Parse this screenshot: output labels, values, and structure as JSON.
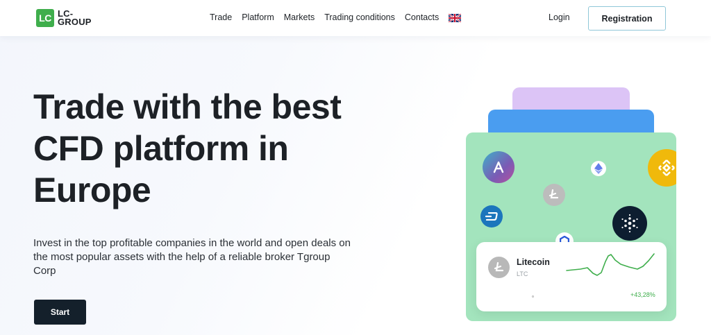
{
  "header": {
    "logo_mark": "LC",
    "logo_text": "LC-GROUP",
    "nav": [
      "Trade",
      "Platform",
      "Markets",
      "Trading conditions",
      "Contacts"
    ],
    "login_label": "Login",
    "registration_label": "Registration"
  },
  "hero": {
    "title": "Trade with the best CFD platform in Europe",
    "description": "Invest in the top profitable companies in the world and open deals on the most popular assets with the help of a reliable broker Tgroup Corp",
    "start_label": "Start"
  },
  "ticker": {
    "name": "Litecoin",
    "symbol": "LTC",
    "change": "+43,28%"
  },
  "icons": {
    "coins": [
      "aave-icon",
      "ethereum-icon",
      "binance-icon",
      "litecoin-icon",
      "dash-icon",
      "cardano-icon",
      "chainlink-icon"
    ]
  },
  "colors": {
    "brand_green": "#3fae4c",
    "start_button": "#14202b",
    "card_green": "#a3e4bd",
    "card_blue": "#4a9df0",
    "card_purple": "#dcc4f6",
    "positive_change": "#3fae4c"
  }
}
